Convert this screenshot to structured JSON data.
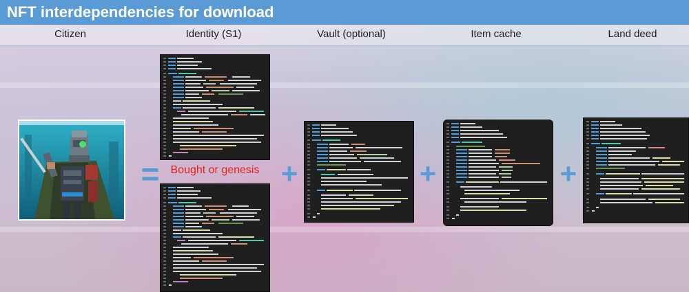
{
  "header": {
    "title": "NFT interdependencies for download"
  },
  "columns": [
    {
      "label": "Citizen"
    },
    {
      "label": "Identity (S1)"
    },
    {
      "label": "Vault (optional)"
    },
    {
      "label": "Item cache"
    },
    {
      "label": "Land deed"
    }
  ],
  "identity_caption": "Bought or genesis",
  "operators": {
    "equals": "=",
    "plus": "+"
  },
  "colors": {
    "title_bar": "#5b9bd5",
    "operator": "#5b9bd5",
    "caption": "#e3221c",
    "code_bg": "#1f1f1f"
  }
}
